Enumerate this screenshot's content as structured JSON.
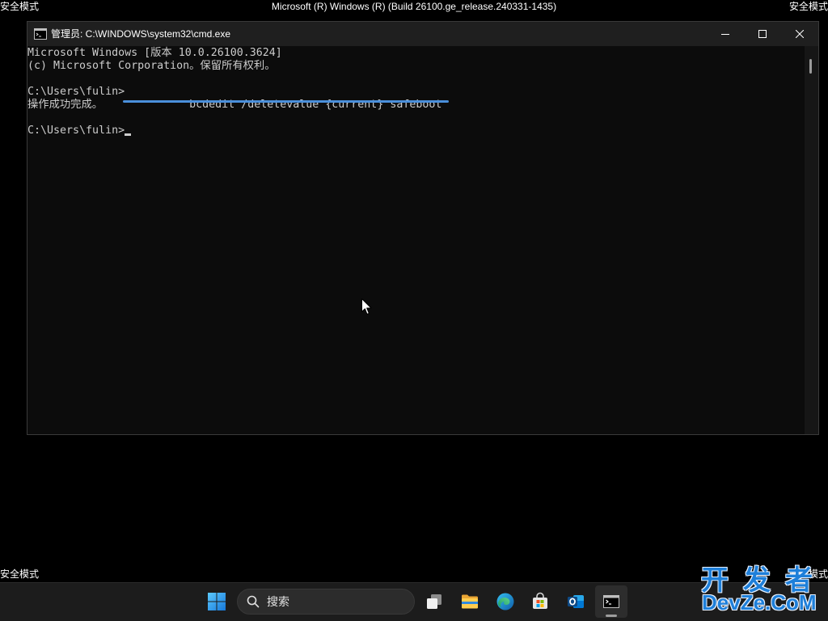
{
  "desktop": {
    "top_left_label": "安全模式",
    "top_center_label": "Microsoft (R) Windows (R) (Build 26100.ge_release.240331-1435)",
    "top_right_label": "安全模式",
    "bottom_left_label": "安全模式",
    "bottom_right_label": "安全模式",
    "pointer_icon": "mouse-pointer-icon"
  },
  "cmd_window": {
    "title": "管理员: C:\\WINDOWS\\system32\\cmd.exe",
    "app_icon": "command-prompt-icon",
    "controls": {
      "minimize_icon": "minimize-icon",
      "maximize_icon": "maximize-icon",
      "close_icon": "close-icon"
    },
    "console": {
      "version_line": "Microsoft Windows [版本 10.0.26100.3624]",
      "copyright_line": "(c) Microsoft Corporation。保留所有权利。",
      "command_prompt": "C:\\Users\\fulin>",
      "command": "bcdedit /deletevalue {current} safeboot",
      "result_line": "操作成功完成。",
      "current_prompt": "C:\\Users\\fulin>"
    }
  },
  "taskbar": {
    "start_icon": "windows-start-icon",
    "search": {
      "icon": "search-icon",
      "placeholder": "搜索"
    },
    "pinned_apps": [
      {
        "icon": "task-view-icon",
        "active": false
      },
      {
        "icon": "file-explorer-icon",
        "active": false
      },
      {
        "icon": "edge-icon",
        "active": false
      },
      {
        "icon": "microsoft-store-icon",
        "active": false
      },
      {
        "icon": "outlook-icon",
        "active": false
      },
      {
        "icon": "command-prompt-icon",
        "active": true
      }
    ]
  },
  "watermark": {
    "line1": "开发者",
    "line2": "DevZe.CoM"
  },
  "colors": {
    "desktop_bg": "#000000",
    "console_bg": "#0c0c0c",
    "console_text": "#cccccc",
    "titlebar_bg": "#1f1f1f",
    "taskbar_bg": "#1c1c1c",
    "annotation_underline": "#4a8fdb",
    "watermark": "#1e7fd9"
  }
}
